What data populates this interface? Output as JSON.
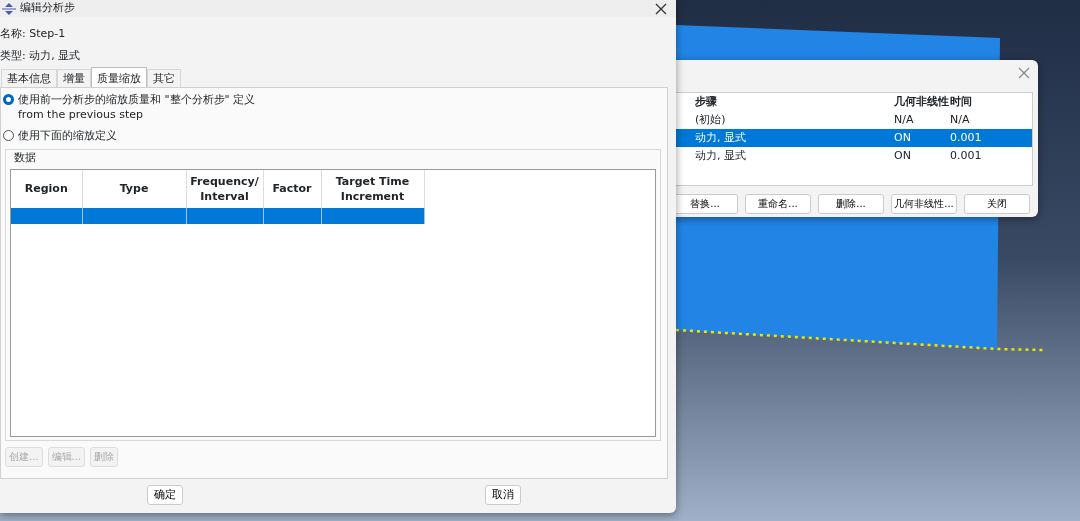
{
  "main_dialog": {
    "title": "编辑分析步",
    "name_label": "名称:",
    "name_value": "Step-1",
    "type_label": "类型:",
    "type_value": "动力, 显式",
    "tabs": [
      {
        "label": "基本信息",
        "selected": false
      },
      {
        "label": "增量",
        "selected": false
      },
      {
        "label": "质量缩放",
        "selected": true
      },
      {
        "label": "其它",
        "selected": false
      }
    ],
    "options": [
      {
        "label": "使用前一分析步的缩放质量和 \"整个分析步\" 定义\nfrom the previous step",
        "selected": true
      },
      {
        "label": "使用下面的缩放定义",
        "selected": false
      }
    ],
    "group_title": "数据",
    "table": {
      "columns": [
        "Region",
        "Type",
        "Frequency/\nInterval",
        "Factor",
        "Target Time\nIncrement"
      ],
      "rows": [
        {
          "selected": true
        }
      ]
    },
    "actions": [
      {
        "label": "创建...",
        "disabled": true
      },
      {
        "label": "编辑...",
        "disabled": true
      },
      {
        "label": "删除",
        "disabled": true
      }
    ],
    "footer_buttons": [
      "确定",
      "取消"
    ]
  },
  "step_manager": {
    "columns": [
      "步骤",
      "几何非线性",
      "时间"
    ],
    "rows": [
      {
        "cells": [
          "(初始)",
          "N/A",
          "N/A"
        ],
        "selected": false
      },
      {
        "cells": [
          "动力, 显式",
          "ON",
          "0.001"
        ],
        "selected": true
      },
      {
        "cells": [
          "动力, 显式",
          "ON",
          "0.001"
        ],
        "selected": false
      }
    ],
    "buttons": [
      "替换...",
      "重命名...",
      "删除...",
      "几何非线性...",
      "关闭"
    ]
  }
}
